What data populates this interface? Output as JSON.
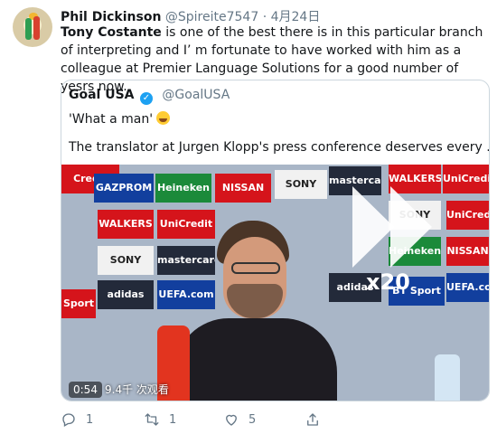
{
  "author": {
    "name": "Phil Dickinson",
    "handle": "@Spireite7547",
    "separator": "·",
    "date": "4月24日"
  },
  "tweet": {
    "mention": "Tony Costante",
    "text": " is one of the best there is in this particular branch of interpreting and I’  m fortunate to have worked with him as a colleague at Premier Language Solutions for a good number of yesrs now."
  },
  "quoted": {
    "name": "Goal USA",
    "handle": "@GoalUSA",
    "text1": "'What a man'",
    "text2": "The translator at Jurgen Klopp's press conference deserves every ...",
    "video": {
      "time": "0:54",
      "views": "9.4千 次观看",
      "speed": "x20",
      "banners": [
        "Credit",
        "GAZPROM",
        "Heineken",
        "NISSAN",
        "SONY",
        "mastercard",
        "WALKERS",
        "UniCredit",
        "WALKERS",
        "UniCredit",
        "SONY XPERIA",
        "mastercard",
        "adidas",
        "UEFA.com",
        "BT Sport",
        "Sport",
        "adidas",
        "NISSAN",
        "UniCredit",
        "SONY",
        "Heineken",
        "UEFA.com"
      ]
    }
  },
  "actions": {
    "reply_count": "1",
    "retweet_count": "1",
    "like_count": "5"
  },
  "colors": {
    "accent": "#1da1f2",
    "muted": "#657786",
    "border": "#ccd6dd"
  }
}
